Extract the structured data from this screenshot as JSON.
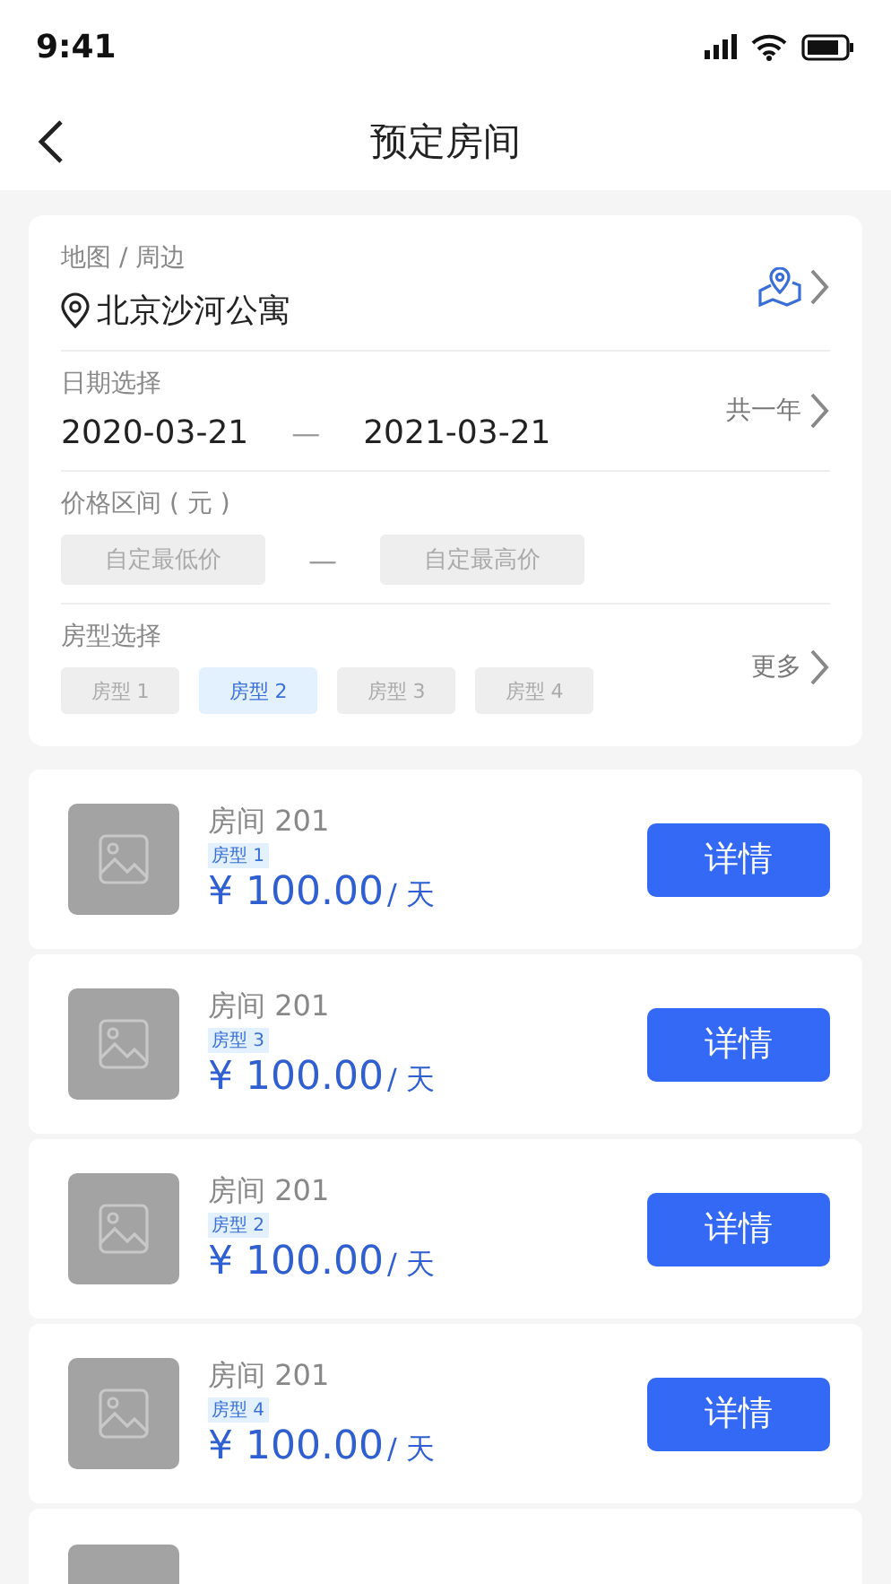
{
  "status_bar": {
    "time": "9:41"
  },
  "header": {
    "title": "预定房间"
  },
  "filters": {
    "location": {
      "label": "地图 / 周边",
      "value": "北京沙河公寓"
    },
    "dates": {
      "label": "日期选择",
      "start": "2020-03-21",
      "separator": "—",
      "end": "2021-03-21",
      "duration": "共一年"
    },
    "price": {
      "label": "价格区间 ( 元 )",
      "min_placeholder": "自定最低价",
      "separator": "—",
      "max_placeholder": "自定最高价"
    },
    "room_types": {
      "label": "房型选择",
      "more": "更多",
      "options": [
        {
          "label": "房型 1",
          "selected": false
        },
        {
          "label": "房型 2",
          "selected": true
        },
        {
          "label": "房型 3",
          "selected": false
        },
        {
          "label": "房型 4",
          "selected": false
        }
      ]
    }
  },
  "rooms": [
    {
      "name": "房间 201",
      "type": "房型 1",
      "price": "¥ 100.00",
      "unit": "/ 天",
      "action": "详情"
    },
    {
      "name": "房间 201",
      "type": "房型 3",
      "price": "¥ 100.00",
      "unit": "/ 天",
      "action": "详情"
    },
    {
      "name": "房间 201",
      "type": "房型 2",
      "price": "¥ 100.00",
      "unit": "/ 天",
      "action": "详情"
    },
    {
      "name": "房间 201",
      "type": "房型 4",
      "price": "¥ 100.00",
      "unit": "/ 天",
      "action": "详情"
    },
    {
      "kind": "cut"
    }
  ]
}
